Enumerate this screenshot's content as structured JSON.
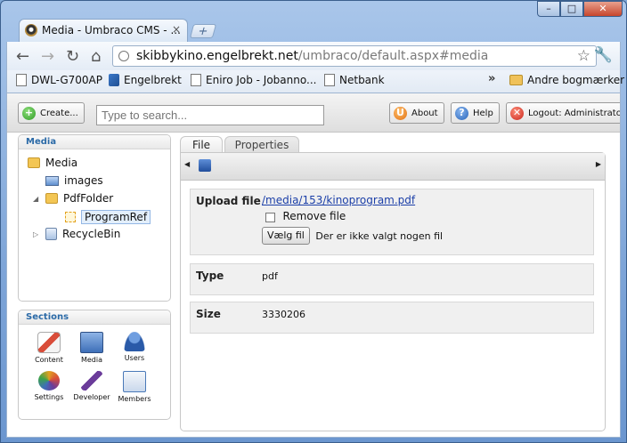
{
  "browser": {
    "tab_title": "Media - Umbraco CMS - ...",
    "tab_close": "×",
    "new_tab": "+",
    "window_buttons": {
      "minimize": "–",
      "maximize": "□",
      "close": "✕"
    },
    "url_domain": "skibbykino.engelbrekt.net",
    "url_path": "/umbraco/default.aspx#media",
    "bookmarks": [
      "DWL-G700AP",
      "Engelbrekt",
      "Eniro Job - Jobanno...",
      "Netbank"
    ],
    "bookmarks_more": "»",
    "other_bookmarks": "Andre bogmærker"
  },
  "umbraco": {
    "create_label": "Create...",
    "search_placeholder": "Type to search...",
    "about_label": "About",
    "help_label": "Help",
    "logout_label": "Logout: Administrator",
    "help_icon_glyph": "?"
  },
  "tree": {
    "header": "Media",
    "items": [
      {
        "label": "Media",
        "icon": "folder-icon"
      },
      {
        "label": "images",
        "icon": "image-icon"
      },
      {
        "label": "PdfFolder",
        "icon": "folder-icon"
      },
      {
        "label": "ProgramRef",
        "icon": "document-icon"
      },
      {
        "label": "RecycleBin",
        "icon": "recycle-bin-icon"
      }
    ]
  },
  "sections": {
    "header": "Sections",
    "items": [
      {
        "label": "Content",
        "color": "#d94d3a"
      },
      {
        "label": "Media",
        "color": "#3e6fb8"
      },
      {
        "label": "Users",
        "color": "#2a5aa8"
      },
      {
        "label": "Settings",
        "color": "#e0a020"
      },
      {
        "label": "Developer",
        "color": "#6b3c9a"
      },
      {
        "label": "Members",
        "color": "#4a79b8"
      }
    ]
  },
  "editor": {
    "tabs": [
      "File",
      "Properties"
    ],
    "upload_label": "Upload file",
    "file_link": "/media/153/kinoprogram.pdf",
    "remove_label": "Remove file",
    "choose_button": "Vælg fil",
    "no_file_text": "Der er ikke valgt nogen fil",
    "type_label": "Type",
    "type_value": "pdf",
    "size_label": "Size",
    "size_value": "3330206"
  }
}
